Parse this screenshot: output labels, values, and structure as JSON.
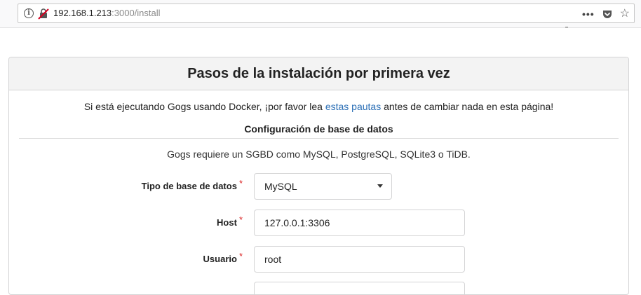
{
  "browser": {
    "url_host": "192.168.1.213",
    "url_path": ":3000/install",
    "more_glyph": "•••",
    "star_glyph": "☆"
  },
  "install": {
    "title": "Pasos de la instalación por primera vez",
    "notice_prefix": "Si está ejecutando Gogs usando Docker, ¡por favor lea ",
    "notice_link": "estas pautas",
    "notice_suffix": " antes de cambiar nada en esta página!",
    "db_section_title": "Configuración de base de datos",
    "db_help": "Gogs requiere un SGBD como MySQL, PostgreSQL, SQLite3 o TiDB.",
    "fields": {
      "db_type": {
        "label": "Tipo de base de datos",
        "required": "*",
        "value": "MySQL"
      },
      "host": {
        "label": "Host",
        "required": "*",
        "value": "127.0.0.1:3306"
      },
      "user": {
        "label": "Usuario",
        "required": "*",
        "value": "root"
      }
    }
  },
  "colors": {
    "link": "#2b6fb6",
    "required": "#db2828",
    "header_bg": "#f3f3f3"
  }
}
